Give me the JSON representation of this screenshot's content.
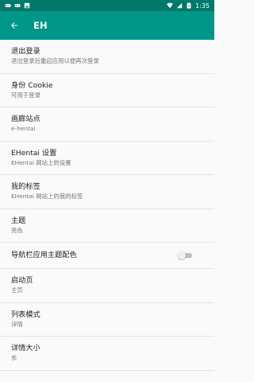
{
  "statusbar": {
    "time": "1:35",
    "bg_color": "#00796b"
  },
  "toolbar": {
    "title": "EH",
    "back_icon": "arrow-back-icon",
    "bg_color": "#009688"
  },
  "settings": [
    {
      "title": "退出登录",
      "subtitle": "退出登录后重启应用以便再次登录"
    },
    {
      "title": "身份 Cookie",
      "subtitle": "可用于登录"
    },
    {
      "title": "画廊站点",
      "subtitle": "e-hentai"
    },
    {
      "title": "EHentai 设置",
      "subtitle": "EHentai 网站上的设置"
    },
    {
      "title": "我的标签",
      "subtitle": "EHentai 网站上的我的标签"
    },
    {
      "title": "主题",
      "subtitle": "亮色"
    },
    {
      "title": "导航栏应用主题配色",
      "switch_on": false
    },
    {
      "title": "启动页",
      "subtitle": "主页"
    },
    {
      "title": "列表模式",
      "subtitle": "详情"
    },
    {
      "title": "详情大小",
      "subtitle": "长"
    }
  ]
}
